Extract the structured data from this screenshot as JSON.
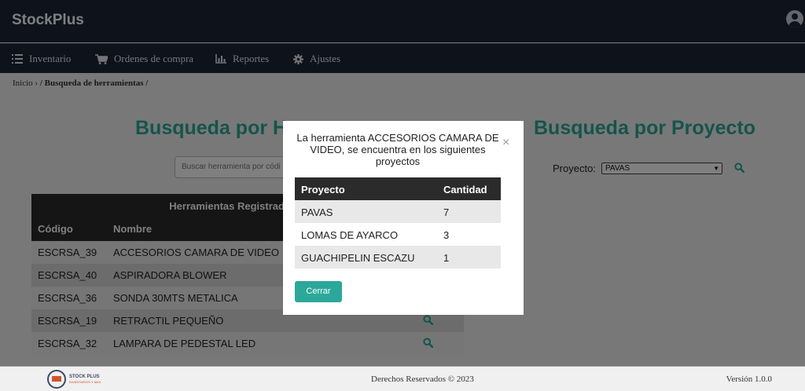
{
  "app": {
    "brand": "StockPlus"
  },
  "nav": {
    "items": [
      {
        "label": "Inventario",
        "icon": "list-icon"
      },
      {
        "label": "Ordenes de compra",
        "icon": "cart-icon"
      },
      {
        "label": "Reportes",
        "icon": "bar-chart-icon"
      },
      {
        "label": "Ajustes",
        "icon": "gear-icon"
      }
    ]
  },
  "breadcrumb": {
    "home": "Inicio",
    "separator": "›",
    "current": "/ Busqueda de herramientas /"
  },
  "left": {
    "heading": "Busqueda por H",
    "search_placeholder": "Buscar herramienta por códi",
    "table": {
      "caption": "Herramientas Registradas en Sa",
      "columns": [
        "Código",
        "Nombre"
      ],
      "rows": [
        {
          "code": "ESCRSA_39",
          "name": "ACCESORIOS CAMARA DE VIDEO",
          "action": false
        },
        {
          "code": "ESCRSA_40",
          "name": "ASPIRADORA BLOWER",
          "action": false
        },
        {
          "code": "ESCRSA_36",
          "name": "SONDA 30MTS METALICA",
          "action": false
        },
        {
          "code": "ESCRSA_19",
          "name": "RETRACTIL PEQUEÑO",
          "action": true
        },
        {
          "code": "ESCRSA_32",
          "name": "LAMPARA DE PEDESTAL LED",
          "action": true
        }
      ]
    }
  },
  "right": {
    "heading": "Busqueda por Proyecto",
    "label": "Proyecto:",
    "selected": "PAVAS"
  },
  "modal": {
    "message": "La herramienta ACCESORIOS CAMARA DE VIDEO, se encuentra en los siguientes proyectos",
    "close_glyph": "×",
    "columns": [
      "Proyecto",
      "Cantidad"
    ],
    "rows": [
      {
        "project": "PAVAS",
        "qty": "7"
      },
      {
        "project": "LOMAS DE AYARCO",
        "qty": "3"
      },
      {
        "project": "GUACHIPELIN ESCAZU",
        "qty": "1"
      }
    ],
    "button": "Cerrar"
  },
  "footer": {
    "logo_text": "STOCK PLUS",
    "logo_sub": "INVENTARIOS Y MAS",
    "copyright": "Derechos Reservados © 2023",
    "version": "Versión 1.0.0"
  },
  "colors": {
    "accent": "#2ba89a",
    "navbar": "#1d2537",
    "table_header": "#2b2b2b"
  }
}
